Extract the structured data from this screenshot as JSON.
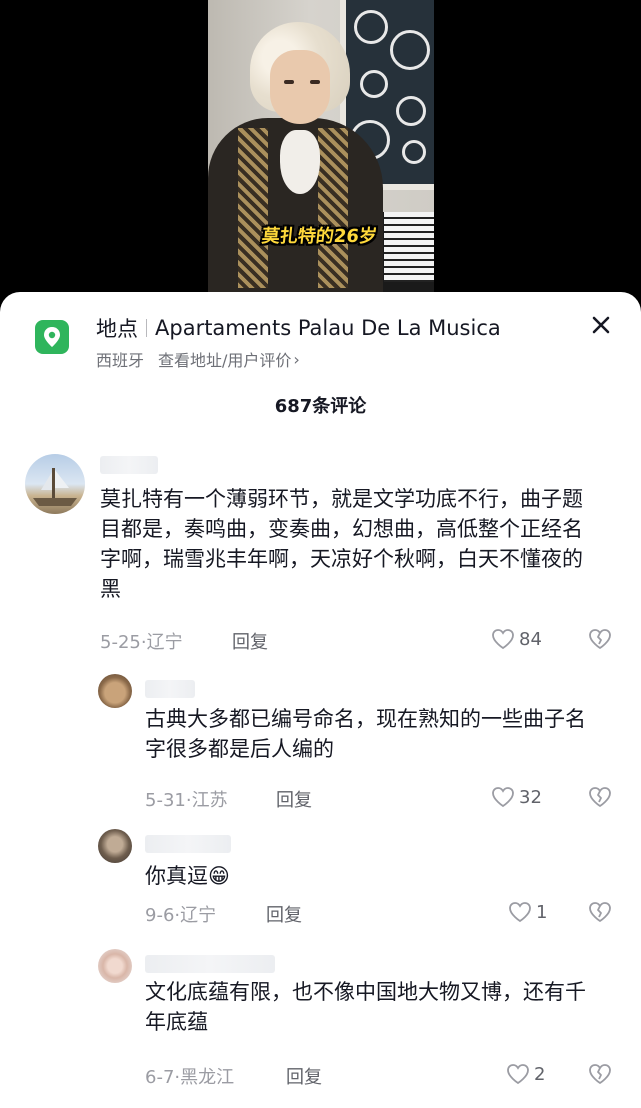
{
  "video": {
    "caption": "莫扎特的26岁"
  },
  "location_card": {
    "label": "地点",
    "place_name": "Apartaments Palau De La Musica",
    "country": "西班牙",
    "link_text": "查看地址/用户评价",
    "chevron": "›",
    "accent_color": "#2fb55c"
  },
  "comments_header": {
    "count_text": "687条评论"
  },
  "comments": [
    {
      "text": "莫扎特有一个薄弱环节，就是文学功底不行，曲子题目都是，奏鸣曲，变奏曲，幻想曲，高低整个正经名字啊，瑞雪兆丰年啊，天凉好个秋啊，白天不懂夜的黑",
      "date_region": "5-25·辽宁",
      "reply_label": "回复",
      "likes": "84"
    },
    {
      "text": "古典大多都已编号命名，现在熟知的一些曲子名字很多都是后人编的",
      "date_region": "5-31·江苏",
      "reply_label": "回复",
      "likes": "32"
    },
    {
      "text": "你真逗",
      "emoji": "😁",
      "date_region": "9-6·辽宁",
      "reply_label": "回复",
      "likes": "1"
    },
    {
      "text": "文化底蕴有限，也不像中国地大物又博，还有千年底蕴",
      "date_region": "6-7·黑龙江",
      "reply_label": "回复",
      "likes": "2"
    }
  ]
}
